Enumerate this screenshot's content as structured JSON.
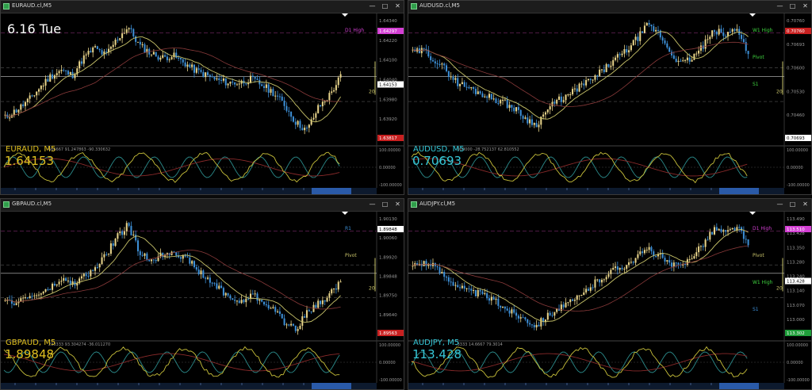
{
  "colors": {
    "bull": "#e8d48a",
    "bear": "#3d8fd6",
    "ma_fast": "#c9c46a",
    "ma_slow": "#5a7a2a",
    "osc_main": "#c8c03a",
    "osc_sig": "#2b8b8b",
    "osc_slow": "#8a2a2a",
    "pink": "#d33fd3",
    "green_label": "#3fd33f",
    "price_box": "#ffffff",
    "red_box": "#c82020",
    "axis_text": "#9a9a9a",
    "yellow_symbol": "#e0c020",
    "cyan_symbol": "#36c8d8"
  },
  "icons": {
    "window": "chart-window-icon",
    "minimize": "minimize-icon",
    "maximize": "maximize-icon",
    "close": "close-icon"
  },
  "date_stamp": "6.16 Tue",
  "panels": [
    {
      "id": "euraud",
      "window_title": "EURAUD.cl,M5",
      "symbol_label": "EURAUD, M5",
      "symbol_color": "yellow",
      "price_display": "1.64153",
      "osc_header": "666667 91.247863 -90.330632",
      "level_labels": [
        {
          "text": "D1 High",
          "color": "pink"
        }
      ],
      "marker_20": "20",
      "y_ticks": [
        "1.64340",
        "1.64220",
        "1.64100",
        "1.64040",
        "1.63980",
        "1.63920",
        "1.63860"
      ],
      "price_boxes": [
        {
          "text": "1.64297",
          "kind": "pink"
        },
        {
          "text": "1.64153",
          "kind": "white"
        },
        {
          "text": "1.63817",
          "kind": "red"
        }
      ],
      "osc_ticks": [
        "100.00000",
        "0.00000",
        "-100.00000"
      ],
      "candles_seed": 11,
      "path": [
        0.22,
        0.28,
        0.35,
        0.45,
        0.55,
        0.6,
        0.56,
        0.7,
        0.78,
        0.72,
        0.85,
        0.95,
        0.8,
        0.74,
        0.7,
        0.72,
        0.66,
        0.6,
        0.56,
        0.52,
        0.5,
        0.5,
        0.53,
        0.48,
        0.42,
        0.32,
        0.18,
        0.12,
        0.3,
        0.4,
        0.55
      ]
    },
    {
      "id": "audusd",
      "window_title": "AUDUSD.cl,M5",
      "symbol_label": "AUDUSD, M5",
      "symbol_color": "cyan",
      "price_display": "0.70693",
      "osc_header": ".000000 -28.752137 62.810552",
      "level_labels": [
        {
          "text": "W1 High",
          "color": "green"
        },
        {
          "text": "Pivot",
          "color": "green"
        },
        {
          "text": "S1",
          "color": "green"
        }
      ],
      "marker_20": "20",
      "y_ticks": [
        "0.70760",
        "0.70693",
        "0.70600",
        "0.70530",
        "0.70460",
        "0.70400"
      ],
      "price_boxes": [
        {
          "text": "0.70760",
          "kind": "red"
        },
        {
          "text": "0.70693",
          "kind": "white"
        }
      ],
      "osc_ticks": [
        "100.00000",
        "0.00000",
        "-100.00000"
      ],
      "candles_seed": 29,
      "path": [
        0.74,
        0.76,
        0.68,
        0.6,
        0.5,
        0.46,
        0.42,
        0.38,
        0.35,
        0.3,
        0.22,
        0.16,
        0.28,
        0.36,
        0.4,
        0.48,
        0.52,
        0.6,
        0.68,
        0.75,
        0.85,
        0.96,
        0.9,
        0.75,
        0.65,
        0.7,
        0.8,
        0.92,
        0.88,
        0.95,
        0.72
      ]
    },
    {
      "id": "gbpaud",
      "window_title": "GBPAUD.cl,M5",
      "symbol_label": "GBPAUD, M5",
      "symbol_color": "yellow",
      "price_display": "1.89848",
      "osc_header": "233333 93.304274 -36.011270",
      "level_labels": [
        {
          "text": "R1",
          "color": "blue"
        },
        {
          "text": "Pivot",
          "color": "yellow"
        }
      ],
      "marker_20": "20",
      "y_ticks": [
        "1.90130",
        "1.90060",
        "1.89920",
        "1.89848",
        "1.89750",
        "1.89640",
        "1.89580"
      ],
      "price_boxes": [
        {
          "text": "1.89848",
          "kind": "white"
        },
        {
          "text": "1.89563",
          "kind": "red"
        }
      ],
      "osc_ticks": [
        "100.00000",
        "0.00000",
        "-100.00000"
      ],
      "candles_seed": 47,
      "path": [
        0.3,
        0.32,
        0.35,
        0.38,
        0.42,
        0.5,
        0.46,
        0.52,
        0.58,
        0.7,
        0.85,
        0.95,
        0.72,
        0.66,
        0.7,
        0.74,
        0.68,
        0.6,
        0.5,
        0.44,
        0.36,
        0.3,
        0.38,
        0.32,
        0.26,
        0.14,
        0.1,
        0.22,
        0.3,
        0.38,
        0.48
      ]
    },
    {
      "id": "audjpy",
      "window_title": "AUDJPY.cl,M5",
      "symbol_label": "AUDJPY, M5",
      "symbol_color": "cyan",
      "price_display": "113.428",
      "osc_header": ".3333 14.6667 79.3014",
      "level_labels": [
        {
          "text": "D1 High",
          "color": "pink"
        },
        {
          "text": "Pivot",
          "color": "yellow"
        },
        {
          "text": "W1 High",
          "color": "green"
        },
        {
          "text": "S1",
          "color": "blue"
        }
      ],
      "marker_20": "20",
      "y_ticks": [
        "113.490",
        "113.428",
        "113.350",
        "113.280",
        "113.240",
        "113.140",
        "113.070",
        "113.000",
        "112.930"
      ],
      "price_boxes": [
        {
          "text": "113.510",
          "kind": "pink"
        },
        {
          "text": "113.428",
          "kind": "white"
        },
        {
          "text": "113.302",
          "kind": "green"
        }
      ],
      "osc_ticks": [
        "100.00000",
        "0.00000",
        "-100.00000"
      ],
      "candles_seed": 63,
      "path": [
        0.62,
        0.64,
        0.6,
        0.52,
        0.45,
        0.4,
        0.38,
        0.34,
        0.28,
        0.22,
        0.18,
        0.12,
        0.2,
        0.26,
        0.3,
        0.36,
        0.45,
        0.52,
        0.58,
        0.62,
        0.68,
        0.75,
        0.7,
        0.62,
        0.6,
        0.7,
        0.8,
        0.92,
        0.88,
        0.94,
        0.78
      ]
    }
  ]
}
